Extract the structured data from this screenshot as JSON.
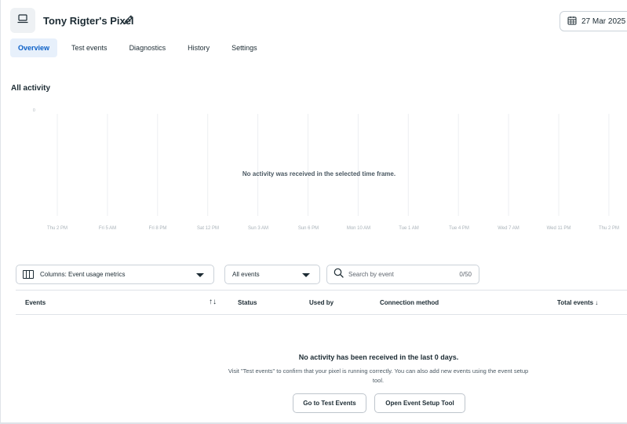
{
  "header": {
    "pixel_name": "Tony Rigter's Pixel",
    "date_range": "27 Mar 2025 -"
  },
  "tabs": [
    {
      "label": "Overview",
      "active": true
    },
    {
      "label": "Test events",
      "active": false
    },
    {
      "label": "Diagnostics",
      "active": false
    },
    {
      "label": "History",
      "active": false
    },
    {
      "label": "Settings",
      "active": false
    }
  ],
  "activity": {
    "title": "All activity",
    "empty_message": "No activity was received in the selected time frame.",
    "y_tick": "0",
    "x_labels": [
      "Thu 2 PM",
      "Fri 5 AM",
      "Fri 8 PM",
      "Sat 12 PM",
      "Sun 3 AM",
      "Sun 6 PM",
      "Mon 10 AM",
      "Tue 1 AM",
      "Tue 4 PM",
      "Wed 7 AM",
      "Wed 11 PM",
      "Thu 2 PM"
    ]
  },
  "filters": {
    "columns_label": "Columns: Event usage metrics",
    "events_label": "All events",
    "search_placeholder": "Search by event",
    "search_count": "0/50"
  },
  "table": {
    "headers": {
      "events": "Events",
      "sort": "↑↓",
      "status": "Status",
      "used_by": "Used by",
      "connection_method": "Connection method",
      "total_events": "Total events ↓"
    }
  },
  "empty_state": {
    "title": "No activity has been received in the last 0 days.",
    "description": "Visit \"Test events\" to confirm that your pixel is running correctly. You can also add new events using the event setup tool.",
    "primary_button": "Go to Test Events",
    "secondary_button": "Open Event Setup Tool"
  },
  "icons": {
    "pixel": "monitor-icon",
    "edit": "pencil-icon",
    "calendar": "calendar-icon",
    "columns": "columns-icon",
    "dropdown": "caret-down-icon",
    "search": "search-icon"
  },
  "colors": {
    "accent": "#0a5fc7",
    "active_tab_bg": "#e7f0fb",
    "text": "#1c2b33",
    "border": "#cbd2d9"
  }
}
